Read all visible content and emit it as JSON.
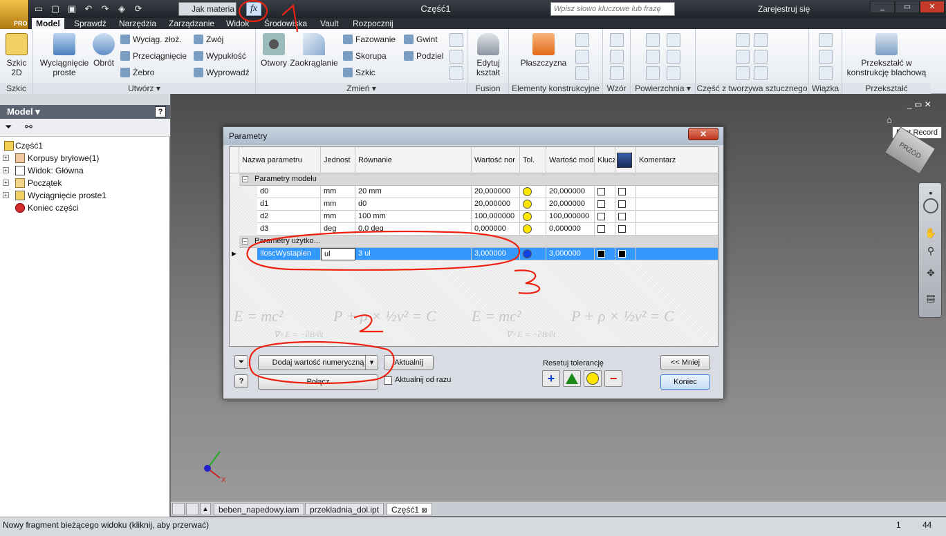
{
  "app": {
    "title": "Część1",
    "edition": "PRO",
    "material": "Jak materia",
    "search_placeholder": "Wpisz słowo kluczowe lub frazę",
    "register": "Zarejestruj się",
    "fx": "fx"
  },
  "tabs": [
    "Model",
    "Sprawdź",
    "Narzędzia",
    "Zarządzanie",
    "Widok",
    "Środowiska",
    "Vault",
    "Rozpocznij"
  ],
  "ribbon": {
    "szkic": {
      "tool": "Szkic 2D",
      "label": "Szkic"
    },
    "utworz": {
      "big": [
        "Wyciągnięcie proste",
        "Obrót"
      ],
      "small": [
        "Wyciąg. złoż.",
        "Przeciągnięcie",
        "Żebro",
        "Zwój",
        "Wypukłość",
        "Wyprowadź"
      ],
      "label": "Utwórz"
    },
    "zmien": {
      "big": [
        "Otwory",
        "Zaokrąglanie"
      ],
      "small": [
        "Fazowanie",
        "Skorupa",
        "Szkic",
        "Gwint",
        "Podziel"
      ],
      "label": "Zmień"
    },
    "fusion": {
      "tool": "Edytuj kształt",
      "label": "Fusion"
    },
    "elementy": {
      "tool": "Płaszczyzna",
      "label": "Elementy konstrukcyjne"
    },
    "wzor": {
      "label": "Wzór"
    },
    "powierzchnia": {
      "label": "Powierzchnia"
    },
    "tworzywo": {
      "label": "Część z tworzywa sztucznego"
    },
    "wiazka": {
      "label": "Wiązka"
    },
    "przeksztalc": {
      "tool": "Przekształć w konstrukcję blachową",
      "label": "Przekształć"
    }
  },
  "browser": {
    "title": "Model",
    "items": [
      "Część1",
      "Korpusy bryłowe(1)",
      "Widok: Główna",
      "Początek",
      "Wyciągnięcie proste1",
      "Koniec części"
    ]
  },
  "dialog": {
    "title": "Parametry",
    "columns": [
      "Nazwa parametru",
      "Jednost",
      "Równanie",
      "Wartość nor",
      "Tol.",
      "Wartość mod",
      "Klucz",
      "",
      "Komentarz"
    ],
    "group_model": "Parametry modelu",
    "group_user": "Parametry użytko...",
    "rows": [
      {
        "name": "d0",
        "unit": "mm",
        "eq": "20 mm",
        "nom": "20,000000",
        "mod": "20,000000"
      },
      {
        "name": "d1",
        "unit": "mm",
        "eq": "d0",
        "nom": "20,000000",
        "mod": "20,000000"
      },
      {
        "name": "d2",
        "unit": "mm",
        "eq": "100 mm",
        "nom": "100,000000",
        "mod": "100,000000"
      },
      {
        "name": "d3",
        "unit": "deg",
        "eq": "0,0 deg",
        "nom": "0,000000",
        "mod": "0,000000"
      }
    ],
    "user_row": {
      "name": "IloscWystapien",
      "unit": "ul",
      "eq": "3 ul",
      "nom": "3,000000",
      "mod": "3,000000"
    },
    "add_button": "Dodaj wartość numeryczną",
    "update_button": "Aktualnij",
    "link_button": "Połącz",
    "immediate_update": "Aktualnij od razu",
    "reset_tolerance": "Resetuj tolerancję",
    "less_button": "<< Mniej",
    "done_button": "Koniec"
  },
  "viewcube": {
    "face": "PRZÓD",
    "tooltip": "First Record"
  },
  "doc_tabs": [
    "beben_napedowy.iam",
    "przekladnia_dol.ipt",
    "Część1"
  ],
  "status": {
    "text": "Nowy fragment bieżącego widoku (kliknij, aby przerwać)",
    "n1": "1",
    "n2": "44"
  },
  "annotations": {
    "a1": "1",
    "a2": "2",
    "a3": "3"
  }
}
